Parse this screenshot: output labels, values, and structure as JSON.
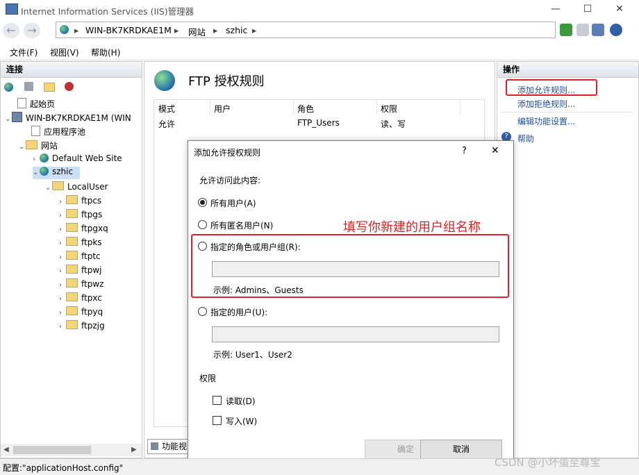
{
  "window": {
    "title": "Internet Information Services (IIS)管理器",
    "min": "—",
    "max": "☐",
    "close": "✕"
  },
  "address": {
    "back": "←",
    "forward": "→",
    "segments": [
      "WIN-BK7KRDKAE1M",
      "网站",
      "szhic"
    ],
    "sep": "▸"
  },
  "menu": [
    "文件(F)",
    "视图(V)",
    "帮助(H)"
  ],
  "left": {
    "header": "连接",
    "tree": [
      {
        "label": "起始页",
        "icon": "page-icon"
      },
      {
        "label": "WIN-BK7KRDKAE1M (WIN",
        "icon": "server-icon"
      },
      {
        "label": "应用程序池",
        "icon": "page-icon"
      },
      {
        "label": "网站",
        "icon": "folder-icon"
      },
      {
        "label": "Default Web Site",
        "icon": "globe-icon"
      },
      {
        "label": "szhic",
        "icon": "globe-icon"
      },
      {
        "label": "LocalUser",
        "icon": "folder-icon"
      },
      {
        "label": "ftpcs",
        "icon": "folder-icon"
      },
      {
        "label": "ftpgs",
        "icon": "folder-icon"
      },
      {
        "label": "ftpgxq",
        "icon": "folder-icon"
      },
      {
        "label": "ftpks",
        "icon": "folder-icon"
      },
      {
        "label": "ftptc",
        "icon": "folder-icon"
      },
      {
        "label": "ftpwj",
        "icon": "folder-icon"
      },
      {
        "label": "ftpwz",
        "icon": "folder-icon"
      },
      {
        "label": "ftpxc",
        "icon": "folder-icon"
      },
      {
        "label": "ftpyq",
        "icon": "folder-icon"
      },
      {
        "label": "ftpzjg",
        "icon": "folder-icon"
      }
    ]
  },
  "center": {
    "title": "FTP 授权规则",
    "columns": [
      "模式",
      "用户",
      "角色",
      "权限"
    ],
    "row": [
      "允许",
      "",
      "FTP_Users",
      "读、写"
    ],
    "bottom_tab": "功能视"
  },
  "right": {
    "header": "操作",
    "actions": [
      "添加允许规则...",
      "添加拒绝规则...",
      "编辑功能设置...",
      "帮助"
    ]
  },
  "dialog": {
    "title": "添加允许授权规则",
    "help": "?",
    "close": "✕",
    "prompt": "允许访问此内容:",
    "options": [
      "所有用户(A)",
      "所有匿名用户(N)",
      "指定的角色或用户组(R):",
      "指定的用户(U):"
    ],
    "role_value": "",
    "role_example": "示例: Admins、Guests",
    "user_value": "",
    "user_example": "示例: User1、User2",
    "permissions_label": "权限",
    "read": "读取(D)",
    "write": "写入(W)",
    "ok": "确定",
    "cancel": "取消"
  },
  "annotation": {
    "text": "填写你新建的用户组名称",
    "color": "#e02020"
  },
  "status": "配置:\"applicationHost.config\"",
  "watermark": "CSDN @小坏蛋至尊宝"
}
